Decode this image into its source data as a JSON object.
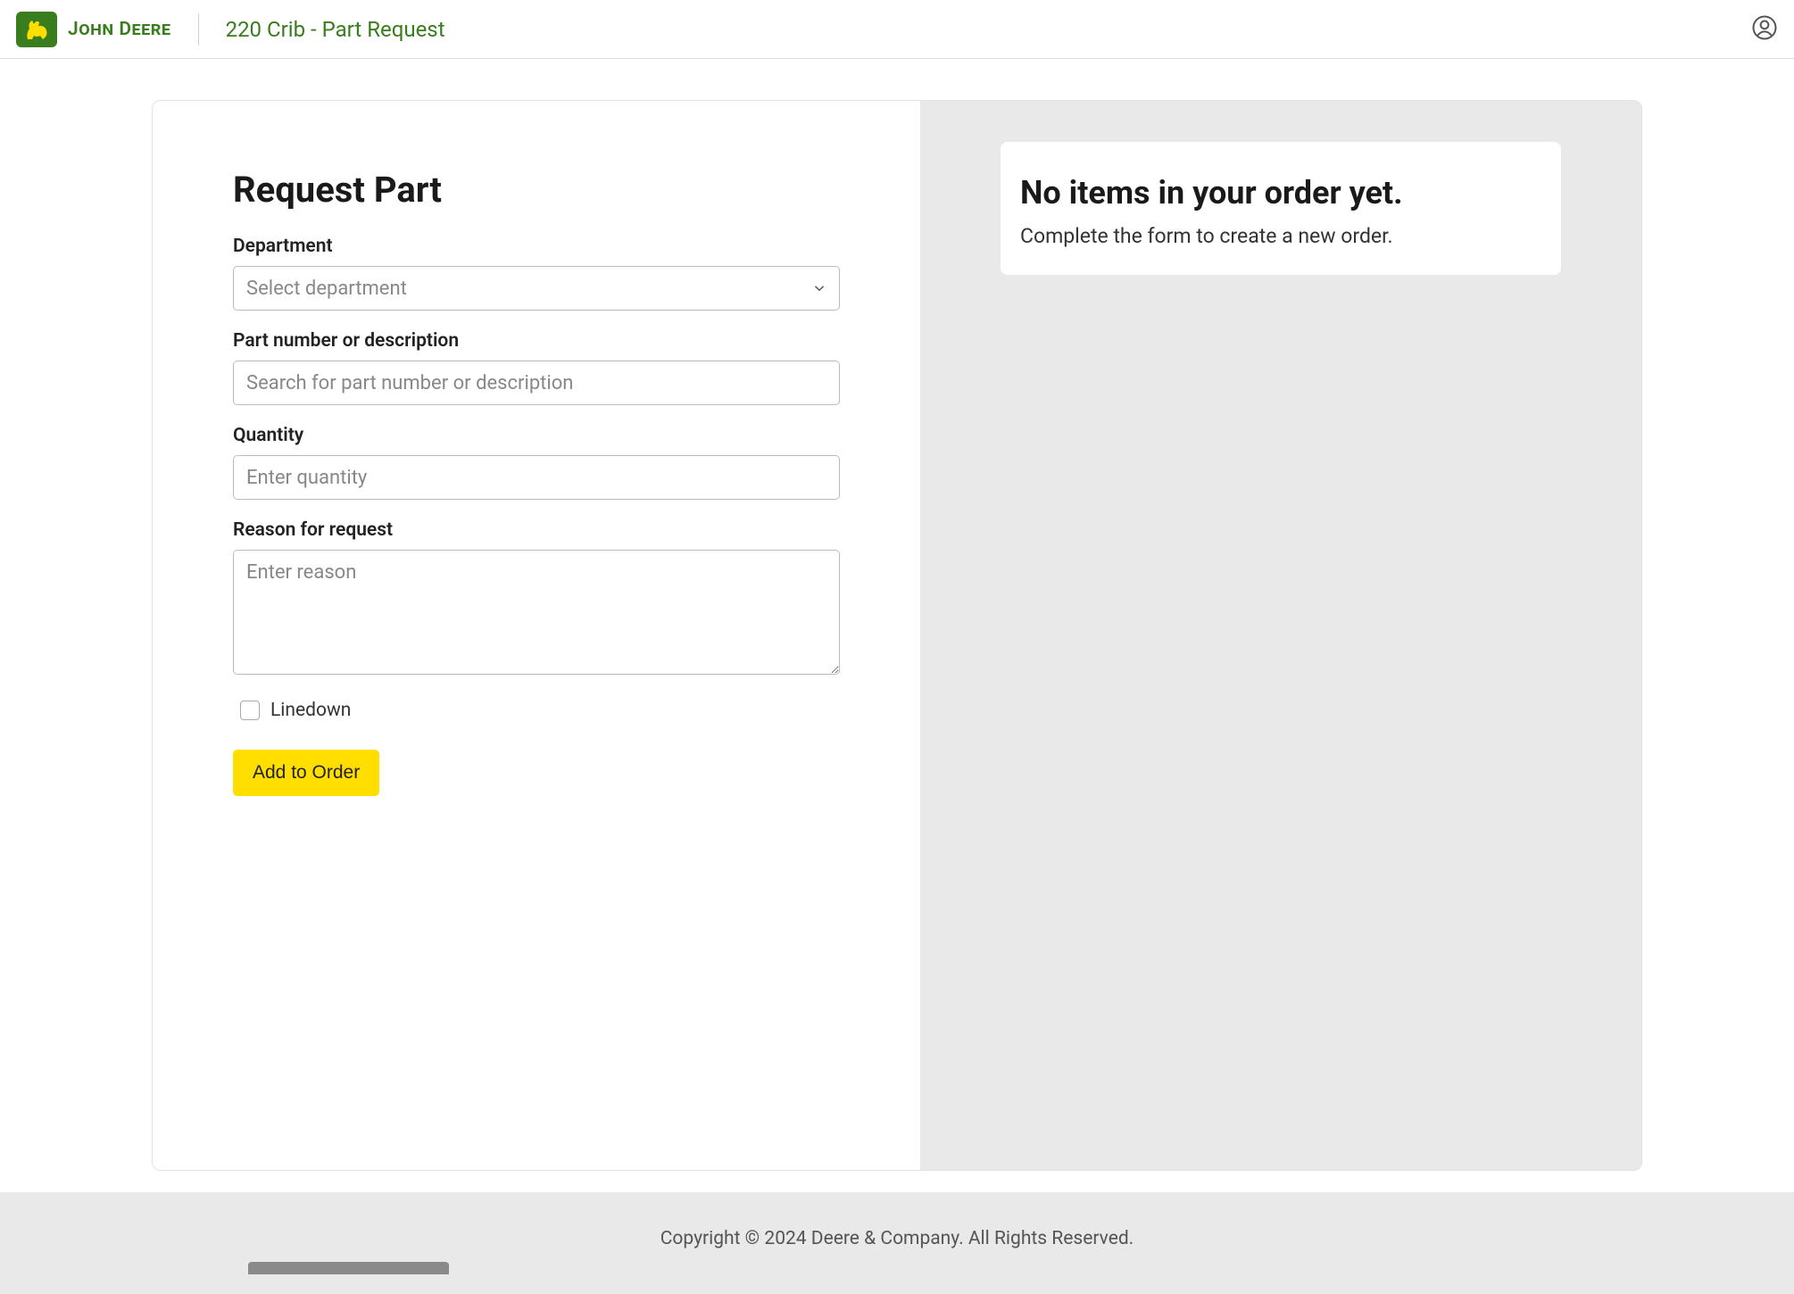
{
  "header": {
    "brand": "John Deere",
    "page_title": "220 Crib - Part Request"
  },
  "form": {
    "title": "Request Part",
    "department": {
      "label": "Department",
      "placeholder": "Select department"
    },
    "part": {
      "label": "Part number or description",
      "placeholder": "Search for part number or description"
    },
    "quantity": {
      "label": "Quantity",
      "placeholder": "Enter quantity"
    },
    "reason": {
      "label": "Reason for request",
      "placeholder": "Enter reason"
    },
    "linedown": {
      "label": "Linedown",
      "checked": false
    },
    "add_button": "Add to Order"
  },
  "order": {
    "empty_title": "No items in your order yet.",
    "empty_sub": "Complete the form to create a new order."
  },
  "footer": {
    "copyright": "Copyright © 2024 Deere & Company. All Rights Reserved."
  }
}
